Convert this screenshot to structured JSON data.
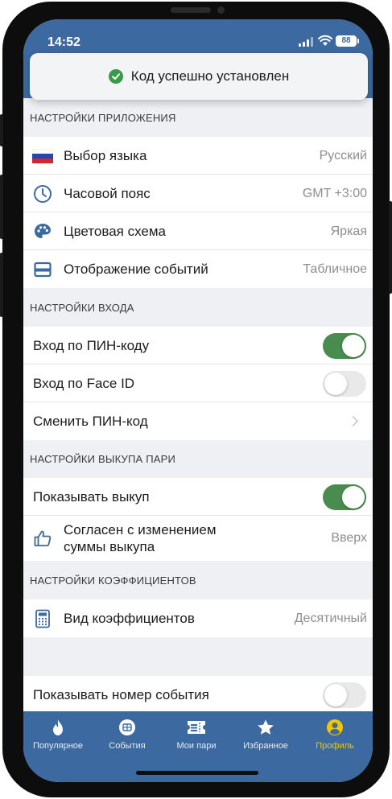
{
  "status_bar": {
    "time": "14:52",
    "battery": "88"
  },
  "toast": {
    "text": "Код успешно установлен"
  },
  "sections": {
    "app": {
      "title": "НАСТРОЙКИ ПРИЛОЖЕНИЯ",
      "items": [
        {
          "label": "Выбор языка",
          "value": "Русский",
          "icon": "russia-flag-icon"
        },
        {
          "label": "Часовой пояс",
          "value": "GMT +3:00",
          "icon": "clock-icon"
        },
        {
          "label": "Цветовая схема",
          "value": "Яркая",
          "icon": "palette-icon"
        },
        {
          "label": "Отображение событий",
          "value": "Табличное",
          "icon": "table-view-icon"
        }
      ]
    },
    "login": {
      "title": "НАСТРОЙКИ ВХОДА",
      "items": [
        {
          "label": "Вход по ПИН-коду",
          "toggle": true
        },
        {
          "label": "Вход по Face ID",
          "toggle": false
        },
        {
          "label": "Сменить ПИН-код"
        }
      ]
    },
    "buyout": {
      "title": "НАСТРОЙКИ ВЫКУПА ПАРИ",
      "items": [
        {
          "label": "Показывать выкуп",
          "toggle": true
        },
        {
          "label_line1": "Согласен с изменением",
          "label_line2": "суммы выкупа",
          "value": "Вверх",
          "icon": "thumbs-up-icon"
        }
      ]
    },
    "odds": {
      "title": "НАСТРОЙКИ КОЭФФИЦИЕНТОВ",
      "items": [
        {
          "label": "Вид коэффициентов",
          "value": "Десятичный",
          "icon": "calculator-icon"
        }
      ]
    },
    "other": {
      "items": [
        {
          "label": "Показывать номер события",
          "toggle": false
        }
      ]
    }
  },
  "tabbar": {
    "active": "Профиль",
    "accent_color": "#f5c400",
    "items": [
      {
        "label": "Популярное",
        "icon": "flame-icon"
      },
      {
        "label": "События",
        "icon": "ball-icon"
      },
      {
        "label": "Мои пари",
        "icon": "ticket-icon"
      },
      {
        "label": "Избранное",
        "icon": "star-icon"
      },
      {
        "label": "Профиль",
        "icon": "user-icon"
      }
    ]
  },
  "colors": {
    "header_blue": "#3c6aa0",
    "toggle_on": "#4a8c4f",
    "icon_blue": "#3c6aa0"
  }
}
